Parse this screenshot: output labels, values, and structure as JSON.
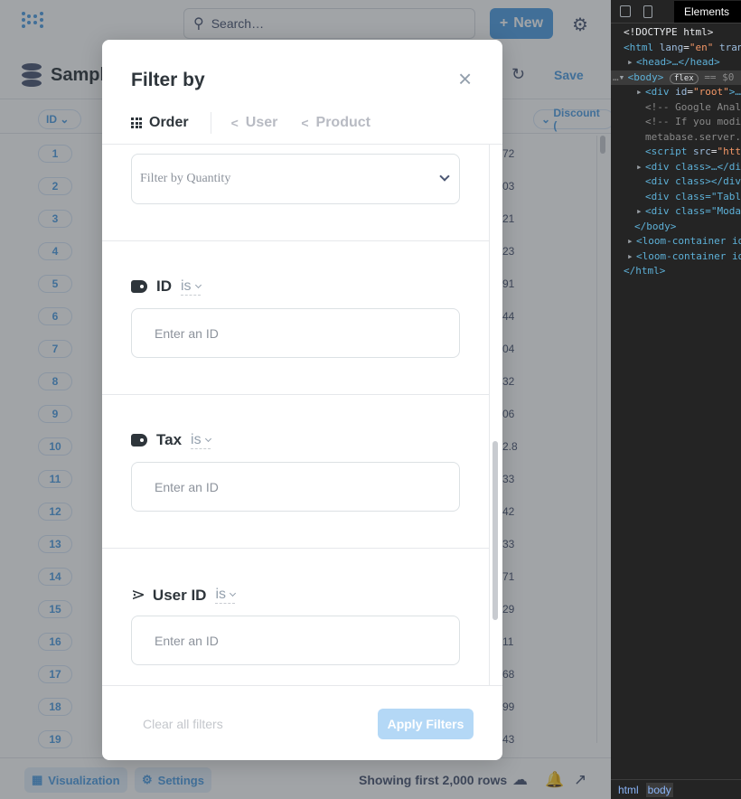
{
  "app": {
    "search_placeholder": "Search…",
    "new_label": "New",
    "question_title": "Sample",
    "save_label": "Save",
    "column_headers": [
      "ID",
      "Discount ("
    ],
    "row_ids": [
      "1",
      "2",
      "3",
      "4",
      "5",
      "6",
      "7",
      "8",
      "9",
      "10",
      "11",
      "12",
      "13",
      "14",
      "15",
      "16",
      "17",
      "18",
      "19"
    ],
    "right_col_values": [
      "72",
      "03",
      "21",
      "23",
      "91",
      "44",
      "04",
      "32",
      "06",
      "2.8",
      "33",
      "42",
      "33",
      "71",
      "29",
      "11",
      "68",
      "99",
      "43"
    ],
    "footer": {
      "visualization_label": "Visualization",
      "settings_label": "Settings",
      "showing_text": "Showing first 2,000 rows"
    }
  },
  "modal": {
    "title": "Filter by",
    "close_label": "×",
    "tabs": [
      {
        "label": "Order",
        "icon": "grid-icon",
        "active": true
      },
      {
        "label": "User",
        "icon": "connections-icon",
        "active": false
      },
      {
        "label": "Product",
        "icon": "connections-icon",
        "active": false
      }
    ],
    "quantity_select_placeholder": "Filter by Quantity",
    "sections": [
      {
        "label": "ID",
        "operator": "is",
        "icon": "tag-icon",
        "input_placeholder": "Enter an ID"
      },
      {
        "label": "Tax",
        "operator": "is",
        "icon": "tag-icon",
        "input_placeholder": "Enter an ID"
      },
      {
        "label": "User ID",
        "operator": "is",
        "icon": "connections-icon",
        "input_placeholder": "Enter an ID"
      }
    ],
    "clear_label": "Clear all filters",
    "apply_label": "Apply Filters"
  },
  "devtools": {
    "tab_label": "Elements",
    "lines": {
      "l1": "<!DOCTYPE html>",
      "l2_tag": "<html",
      "l2_attr": "lang",
      "l2_val": "\"en\"",
      "l2_rest": "tran",
      "l3": "<head>…</head>",
      "l4_tag": "<body>",
      "l4_badge": "flex",
      "l4_rest": "== $0",
      "l5_tag": "<div",
      "l5_attr": "id",
      "l5_val": "\"root\"",
      "l5_rest": ">…",
      "l6": "<!-- Google Anal",
      "l7": "<!-- If you modi",
      "l8": "metabase.server.",
      "l9_tag": "<script",
      "l9_attr": "src",
      "l9_val": "\"htt",
      "l10": "<div class>…</di",
      "l11": "<div class></div",
      "l12": "<div class=\"Tabl",
      "l13": "<div class=\"Moda",
      "l14": "</body>",
      "l15": "<loom-container id",
      "l16": "<loom-container id",
      "l17": "</html>"
    },
    "breadcrumbs": [
      "html",
      "body"
    ]
  },
  "colors": {
    "brand": "#509ee3",
    "text_dark": "#2e353b",
    "apply_disabled": "#b4d8f6",
    "devtools_bg": "#242424"
  }
}
